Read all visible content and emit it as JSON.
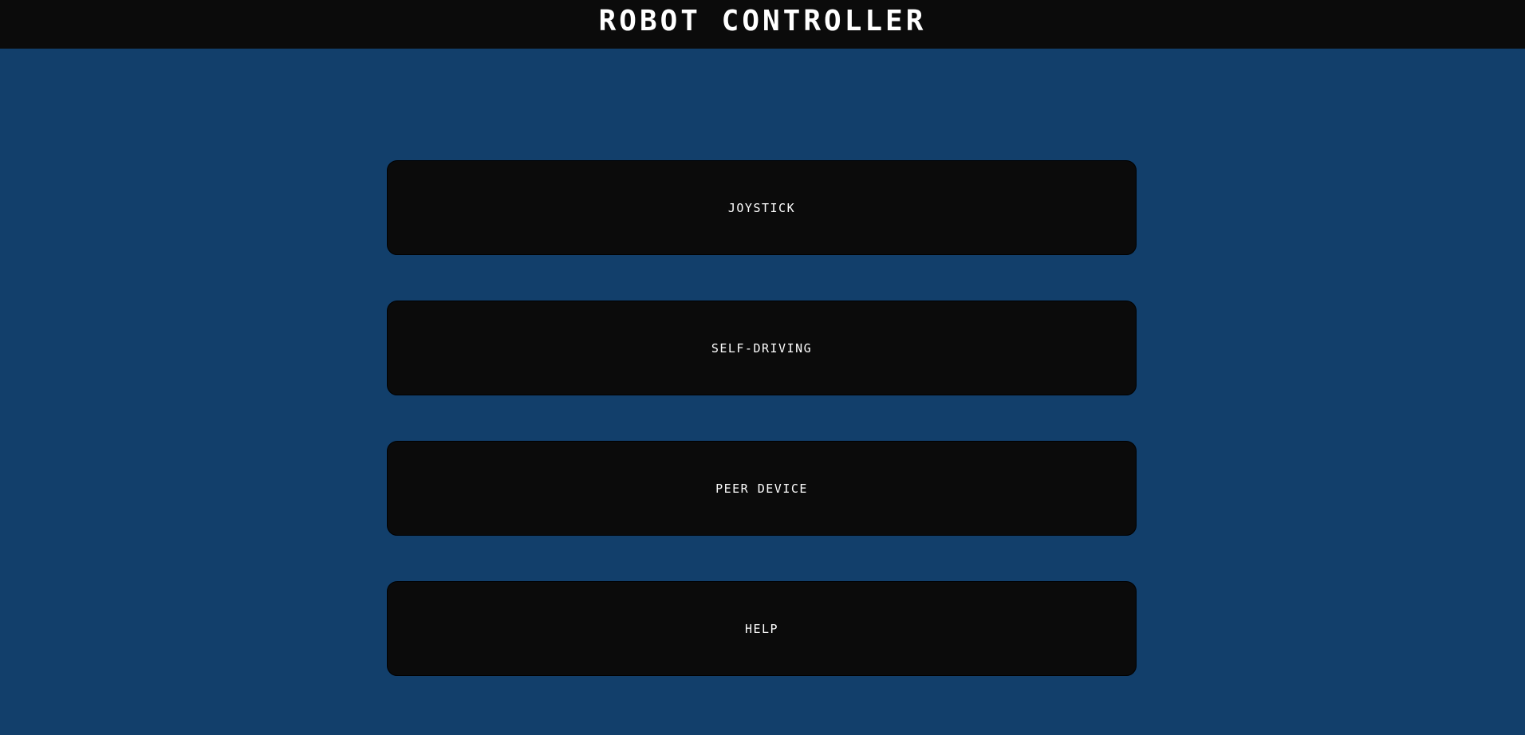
{
  "header": {
    "title": "ROBOT CONTROLLER"
  },
  "menu": {
    "items": [
      {
        "label": "JOYSTICK"
      },
      {
        "label": "SELF-DRIVING"
      },
      {
        "label": "PEER DEVICE"
      },
      {
        "label": "HELP"
      }
    ]
  },
  "colors": {
    "background": "#123f6b",
    "header_bar": "#0b0b0b",
    "button": "#0b0b0b",
    "text": "#ffffff"
  }
}
